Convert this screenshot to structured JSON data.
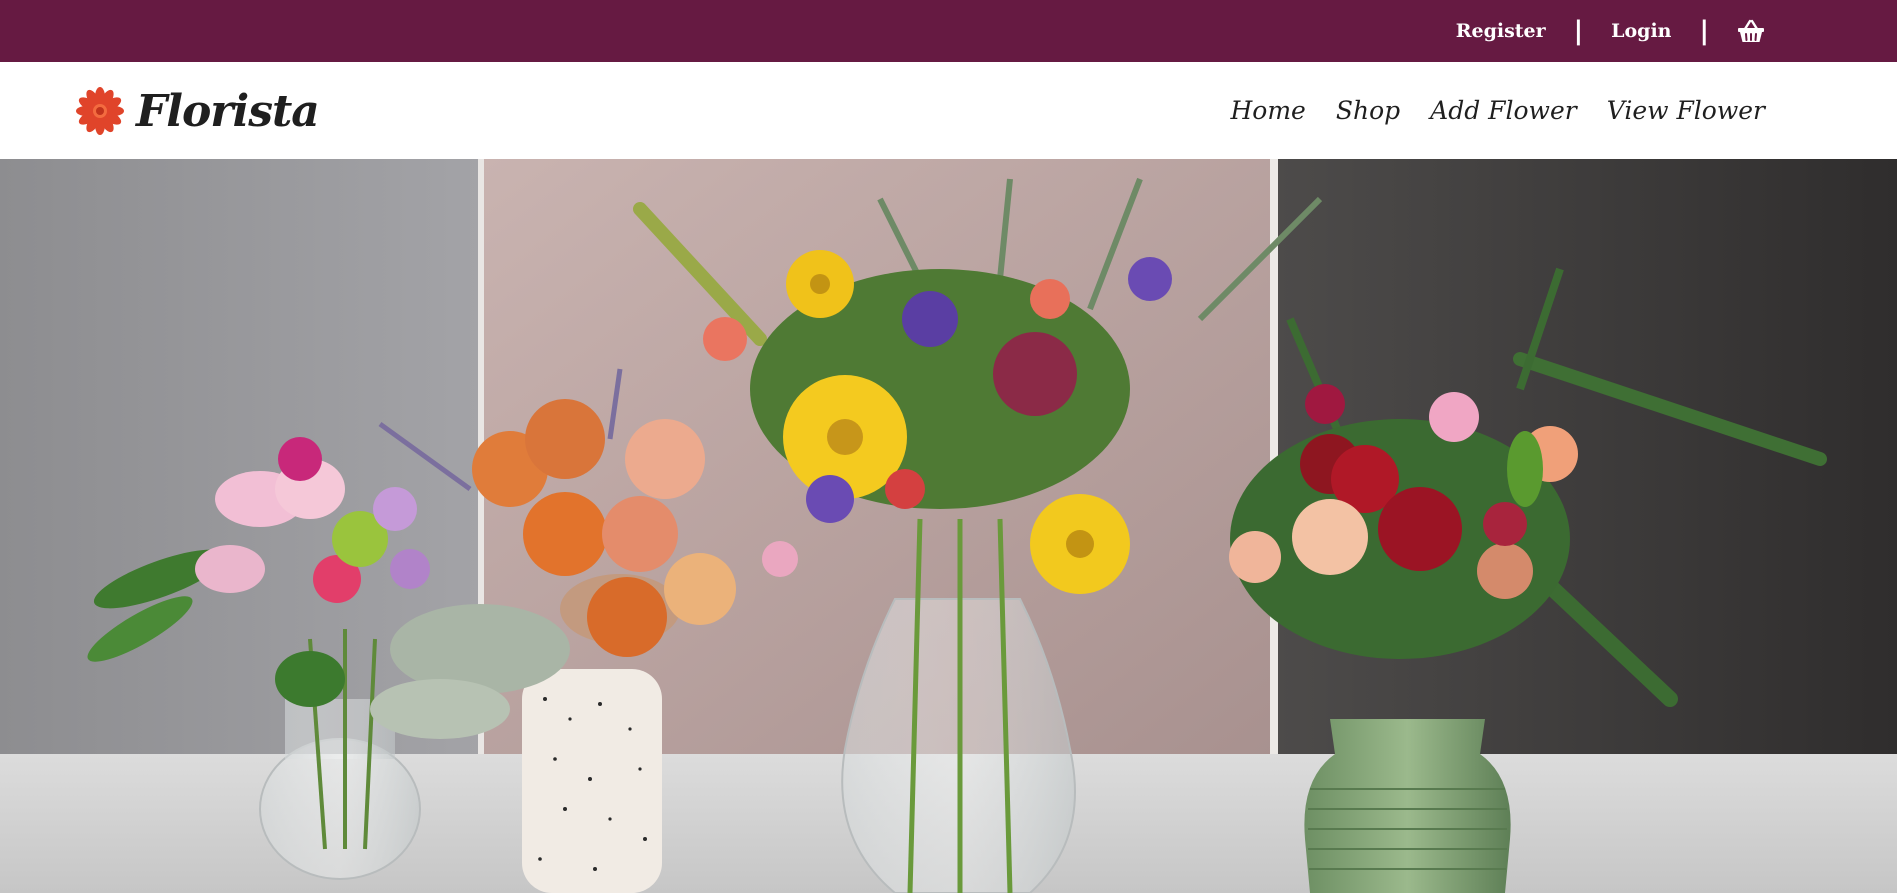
{
  "topbar": {
    "register_label": "Register",
    "separator": "|",
    "login_label": "Login",
    "cart_icon": "shopping-basket-icon"
  },
  "brand": {
    "name": "Florista",
    "logo_icon": "red-flower-icon"
  },
  "nav": {
    "items": [
      {
        "label": "Home"
      },
      {
        "label": "Shop"
      },
      {
        "label": "Add Flower"
      },
      {
        "label": "View Flower"
      }
    ]
  },
  "colors": {
    "topbar_bg": "#661a42",
    "logo_red": "#e0442a",
    "text_dark": "#1f1f1f"
  },
  "hero": {
    "image": "four flower bouquets in vases on a marble table"
  }
}
